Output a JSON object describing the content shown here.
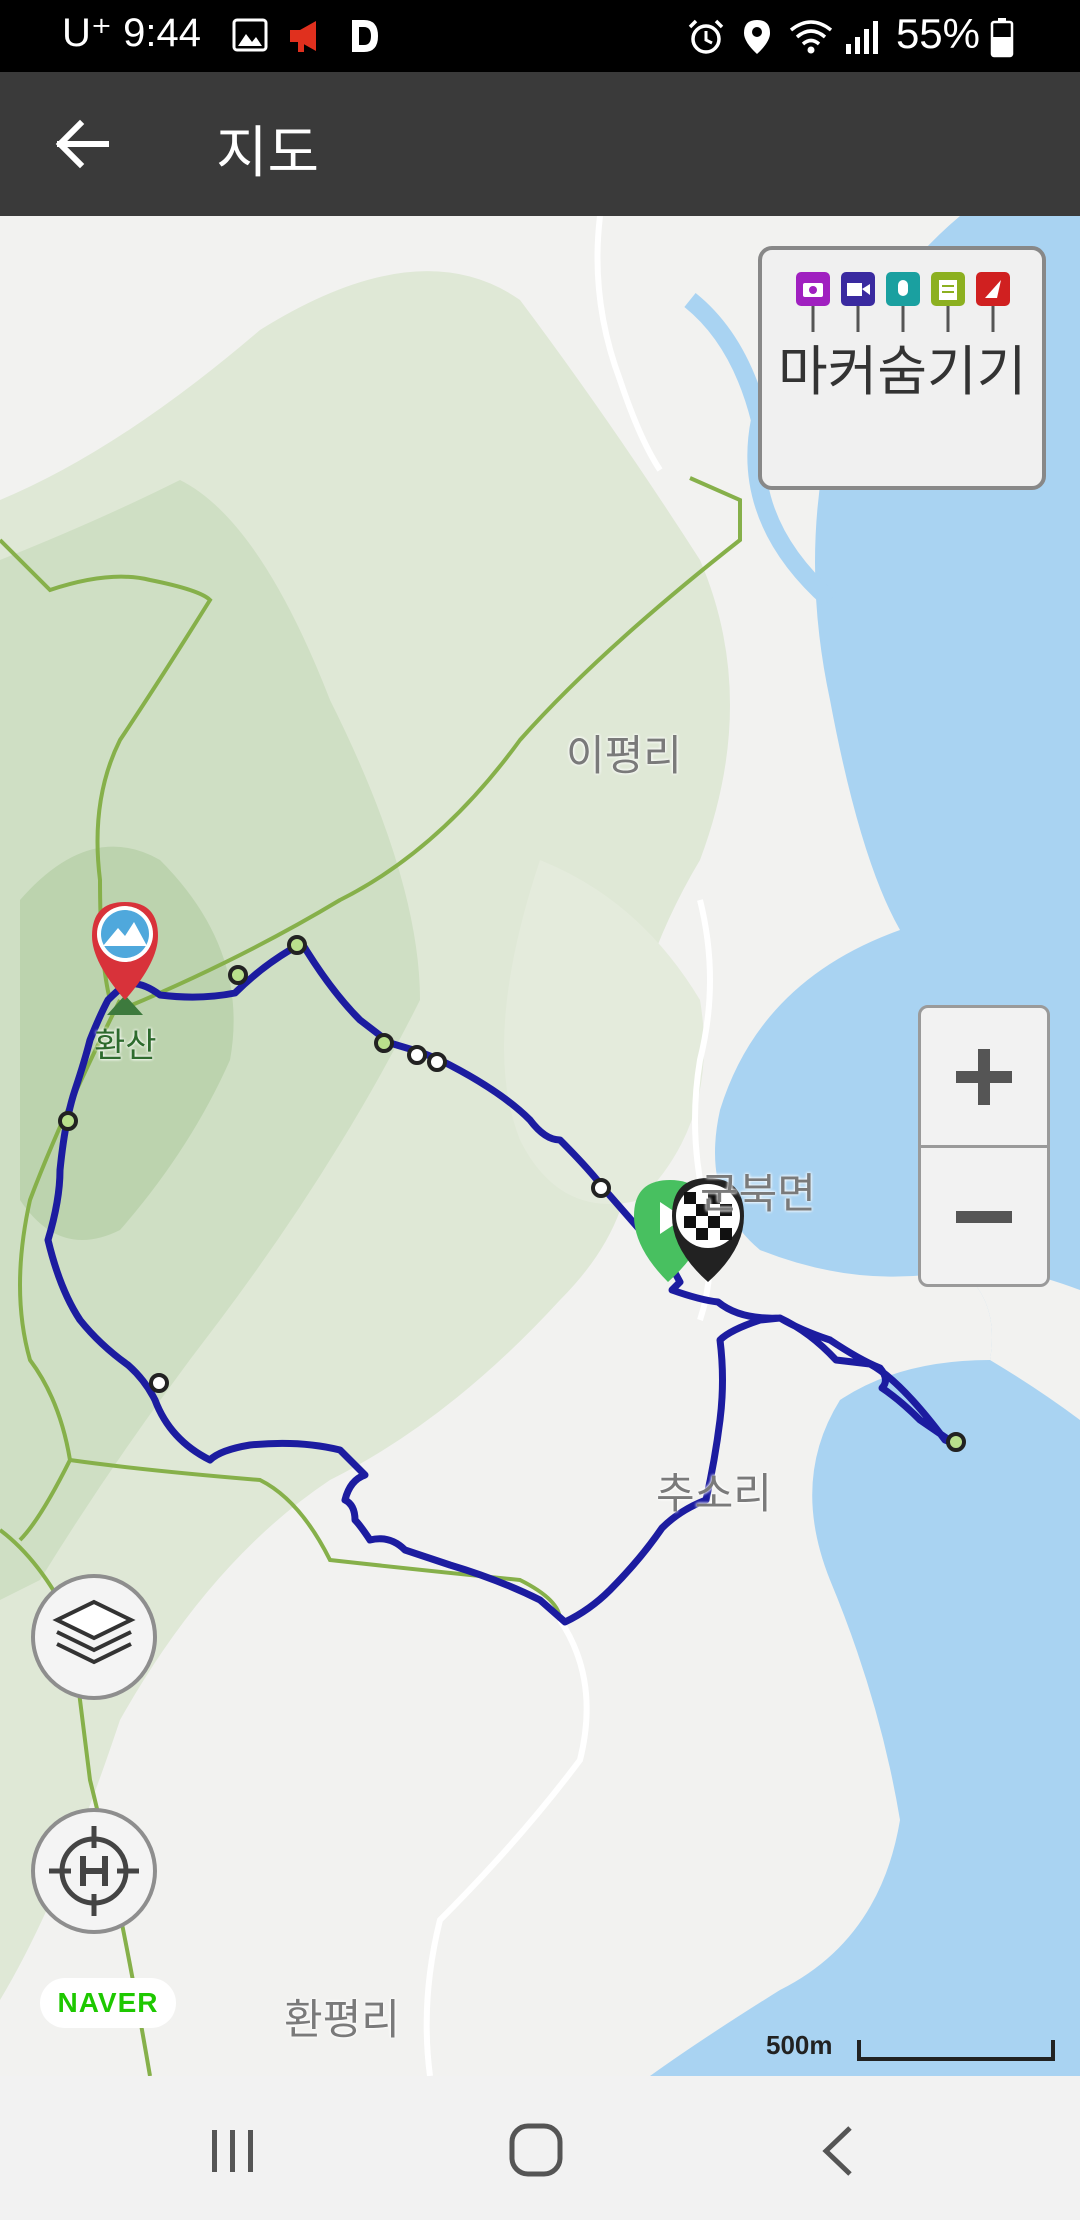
{
  "status_bar": {
    "carrier": "U⁺",
    "time": "9:44",
    "battery": "55%",
    "icons": [
      "image-icon",
      "megaphone-icon",
      "d-app-icon",
      "alarm-icon",
      "location-icon",
      "wifi-icon",
      "signal-icon",
      "battery-icon"
    ]
  },
  "app_bar": {
    "back_icon": "arrow-left-icon",
    "title": "지도"
  },
  "map": {
    "places": {
      "ipyeongri": "이평리",
      "peak": "환산",
      "gunbukmyeon": "군북면",
      "chusori": "추소리",
      "hwanpyeongri": "환평리"
    },
    "marker_panel": {
      "label": "마커숨기기",
      "pin_icons": [
        "camera-pin-icon",
        "video-pin-icon",
        "mic-pin-icon",
        "note-pin-icon",
        "flag-pin-icon"
      ],
      "pin_colors": [
        "#a020c0",
        "#3a2aa0",
        "#1aa0a0",
        "#8cb020",
        "#d02020"
      ]
    },
    "zoom": {
      "plus": "+",
      "minus": "−"
    },
    "layers_icon": "layers-icon",
    "locate_icon": "crosshair-h-icon",
    "provider": "NAVER",
    "scale": "500m",
    "route_color": "#1c1ca0",
    "water_color": "#a9d3f2",
    "road_color": "#86b04a"
  },
  "nav_bar": {
    "icons": [
      "recent-apps-icon",
      "home-icon",
      "back-chevron-icon"
    ]
  }
}
